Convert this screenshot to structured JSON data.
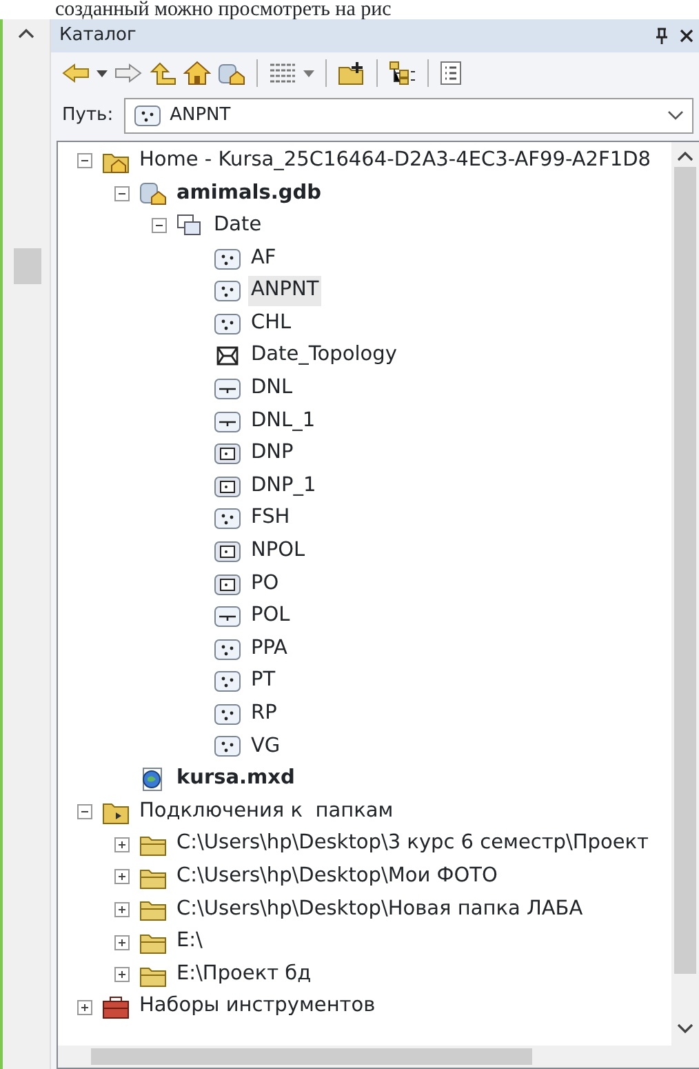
{
  "document_text": "созданный можно просмотреть на рис",
  "window": {
    "title": "Каталог"
  },
  "path": {
    "label": "Путь:",
    "value": "ANPNT",
    "kind": "point_fc"
  },
  "tree": [
    {
      "label": "Home - Kursa_25C16464-D2A3-4EC3-AF99-A2F1D8",
      "kind": "home_folder",
      "expanded": true,
      "selected": false,
      "children": [
        {
          "label": "amimals.gdb",
          "kind": "geodatabase",
          "expanded": true,
          "selected": false,
          "children": [
            {
              "label": "Date",
              "kind": "dataset",
              "expanded": true,
              "selected": false,
              "children": [
                {
                  "label": "AF",
                  "kind": "point_fc",
                  "selected": false
                },
                {
                  "label": "ANPNT",
                  "kind": "point_fc",
                  "selected": true
                },
                {
                  "label": "CHL",
                  "kind": "point_fc",
                  "selected": false
                },
                {
                  "label": "Date_Topology",
                  "kind": "topology",
                  "selected": false
                },
                {
                  "label": "DNL",
                  "kind": "line_fc",
                  "selected": false
                },
                {
                  "label": "DNL_1",
                  "kind": "line_fc",
                  "selected": false
                },
                {
                  "label": "DNP",
                  "kind": "polygon_fc",
                  "selected": false
                },
                {
                  "label": "DNP_1",
                  "kind": "polygon_fc",
                  "selected": false
                },
                {
                  "label": "FSH",
                  "kind": "point_fc",
                  "selected": false
                },
                {
                  "label": "NPOL",
                  "kind": "polygon_fc",
                  "selected": false
                },
                {
                  "label": "PO",
                  "kind": "polygon_fc",
                  "selected": false
                },
                {
                  "label": "POL",
                  "kind": "line_fc",
                  "selected": false
                },
                {
                  "label": "PPA",
                  "kind": "point_fc",
                  "selected": false
                },
                {
                  "label": "PT",
                  "kind": "point_fc",
                  "selected": false
                },
                {
                  "label": "RP",
                  "kind": "point_fc",
                  "selected": false
                },
                {
                  "label": "VG",
                  "kind": "point_fc",
                  "selected": false
                }
              ]
            }
          ]
        },
        {
          "label": "kursa.mxd",
          "kind": "map_document",
          "selected": false
        }
      ]
    },
    {
      "label": "Подключения к  папкам",
      "kind": "folder_connections",
      "expanded": true,
      "selected": false,
      "children": [
        {
          "label": "C:\\Users\\hp\\Desktop\\3 курс 6 семестр\\Проект",
          "kind": "folder",
          "expanded": false,
          "selected": false
        },
        {
          "label": "C:\\Users\\hp\\Desktop\\Мои ФОТО",
          "kind": "folder",
          "expanded": false,
          "selected": false
        },
        {
          "label": "C:\\Users\\hp\\Desktop\\Новая папка ЛАБА",
          "kind": "folder",
          "expanded": false,
          "selected": false
        },
        {
          "label": "E:\\",
          "kind": "folder",
          "expanded": false,
          "selected": false
        },
        {
          "label": "E:\\Проект бд",
          "kind": "folder",
          "expanded": false,
          "selected": false
        }
      ]
    },
    {
      "label": "Наборы инструментов",
      "kind": "toolboxes",
      "expanded": false,
      "selected": false
    }
  ]
}
